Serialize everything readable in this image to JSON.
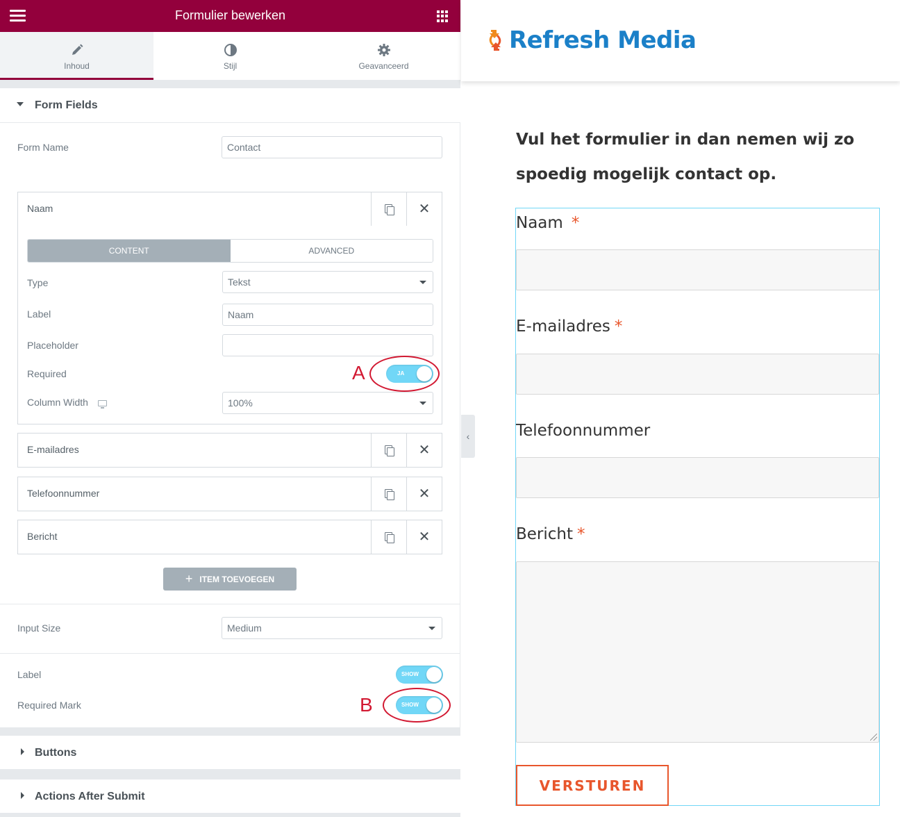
{
  "editor": {
    "title": "Formulier bewerken",
    "tabs": [
      {
        "label": "Inhoud",
        "icon": "pencil-icon",
        "active": true
      },
      {
        "label": "Stijl",
        "icon": "contrast-icon",
        "active": false
      },
      {
        "label": "Geavanceerd",
        "icon": "gear-icon",
        "active": false
      }
    ],
    "form_fields_section": "Form Fields",
    "form_name_label": "Form Name",
    "form_name_value": "Contact",
    "items": [
      {
        "name": "Naam"
      },
      {
        "name": "E-mailadres"
      },
      {
        "name": "Telefoonnummer"
      },
      {
        "name": "Bericht"
      }
    ],
    "item_tabs": {
      "content": "CONTENT",
      "advanced": "ADVANCED"
    },
    "item_fields": {
      "type_label": "Type",
      "type_value": "Tekst",
      "label_label": "Label",
      "label_value": "Naam",
      "placeholder_label": "Placeholder",
      "placeholder_value": "",
      "required_label": "Required",
      "required_toggle": "JA",
      "column_width_label": "Column Width",
      "column_width_value": "100%"
    },
    "add_item": "ITEM TOEVOEGEN",
    "input_size_label": "Input Size",
    "input_size_value": "Medium",
    "label_toggle_label": "Label",
    "label_toggle_value": "SHOW",
    "required_mark_label": "Required Mark",
    "required_mark_value": "SHOW",
    "buttons_section": "Buttons",
    "actions_section": "Actions After Submit"
  },
  "annotations": {
    "a": "A",
    "b": "B",
    "color": "#d21932"
  },
  "preview": {
    "logo_text": "Refresh Media",
    "intro_line1": "Vul het formulier in dan nemen wij zo",
    "intro_line2": "spoedig mogelijk contact op.",
    "fields": [
      {
        "label": "Naam",
        "required": "*"
      },
      {
        "label": "E-mailadres",
        "required": "*"
      },
      {
        "label": "Telefoonnummer",
        "required": ""
      },
      {
        "label": "Bericht",
        "required": "*"
      }
    ],
    "submit": "VERSTUREN"
  },
  "colors": {
    "brand": "#93003c",
    "accent": "#e8562c",
    "toggle": "#71d7f7",
    "logo_blue": "#1b80c8"
  }
}
